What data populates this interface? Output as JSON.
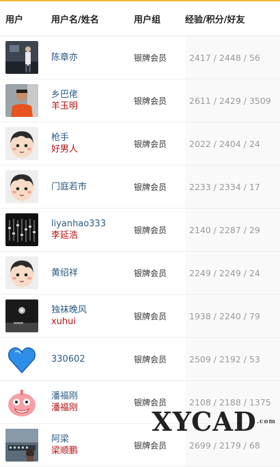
{
  "headers": {
    "avatar": "用户",
    "name": "用户名/姓名",
    "group": "用户组",
    "stats": "经验/积分/好友"
  },
  "colors": {
    "accent_line": "#f2b631",
    "username": "#2a5b86",
    "realname": "#b21212",
    "stats": "#999999"
  },
  "rows": [
    {
      "avatar_icon": "photo-avatar-man-standing",
      "username": "陈章亦",
      "realname": "",
      "group": "银牌会员",
      "stats": "2417 / 2448 / 56"
    },
    {
      "avatar_icon": "photo-avatar-man-orange-shirt",
      "username": "乡巴佬",
      "realname": "羊玉明",
      "group": "银牌会员",
      "stats": "2611 / 2429 / 3509"
    },
    {
      "avatar_icon": "cartoon-avatar-default",
      "username": "枪手",
      "realname": "好男人",
      "group": "银牌会员",
      "stats": "2022 / 2404 / 24"
    },
    {
      "avatar_icon": "cartoon-avatar-default",
      "username": "门庭若市",
      "realname": "",
      "group": "银牌会员",
      "stats": "2233 / 2334 / 17"
    },
    {
      "avatar_icon": "photo-avatar-mixing-console",
      "username": "liyanhao333",
      "realname": "李延浩",
      "group": "银牌会员",
      "stats": "2140 / 2287 / 29"
    },
    {
      "avatar_icon": "cartoon-avatar-default",
      "username": "黄绍祥",
      "realname": "",
      "group": "银牌会员",
      "stats": "2249 / 2249 / 24"
    },
    {
      "avatar_icon": "photo-avatar-dark-scene",
      "username": "独袜晚风",
      "realname": "xuhui",
      "group": "银牌会员",
      "stats": "1938 / 2240 / 79"
    },
    {
      "avatar_icon": "photo-avatar-blue-heart",
      "username": "330602",
      "realname": "",
      "group": "银牌会员",
      "stats": "2509 / 2192 / 53"
    },
    {
      "avatar_icon": "cartoon-avatar-pink-creature",
      "username": "潘福刚",
      "realname": "潘福刚",
      "group": "银牌会员",
      "stats": "2108 / 2188 / 1375"
    },
    {
      "avatar_icon": "photo-avatar-studio",
      "username": "阿梁",
      "realname": "梁顺鹏",
      "group": "银牌会员",
      "stats": "2699 / 2179 / 68"
    }
  ],
  "watermark": {
    "text": "XYCAD",
    "suffix": ".com"
  }
}
